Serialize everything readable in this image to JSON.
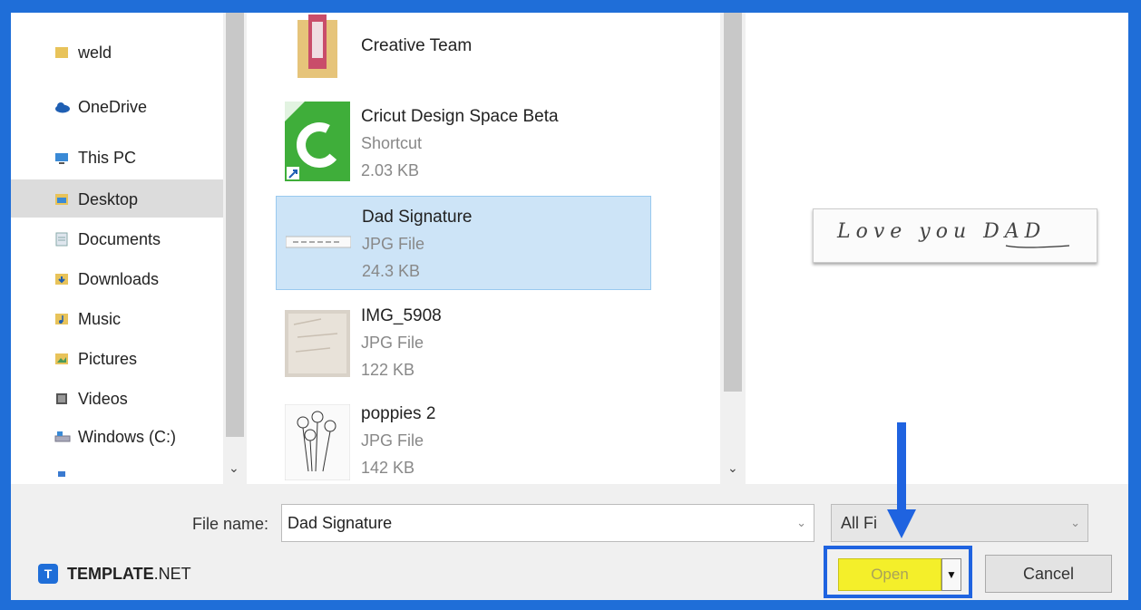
{
  "nav": {
    "items": [
      {
        "label": "weld",
        "icon": "folder-icon"
      },
      {
        "label": "OneDrive",
        "icon": "cloud-icon"
      },
      {
        "label": "This PC",
        "icon": "computer-icon"
      },
      {
        "label": "Desktop",
        "icon": "desktop-folder-icon"
      },
      {
        "label": "Documents",
        "icon": "documents-folder-icon"
      },
      {
        "label": "Downloads",
        "icon": "downloads-folder-icon"
      },
      {
        "label": "Music",
        "icon": "music-folder-icon"
      },
      {
        "label": "Pictures",
        "icon": "pictures-folder-icon"
      },
      {
        "label": "Videos",
        "icon": "videos-folder-icon"
      },
      {
        "label": "Windows (C:)",
        "icon": "drive-icon"
      }
    ],
    "selected": "Desktop"
  },
  "files": [
    {
      "name": "Creative Team",
      "type": "",
      "size": ""
    },
    {
      "name": "Cricut Design Space Beta",
      "type": "Shortcut",
      "size": "2.03 KB"
    },
    {
      "name": "Dad Signature",
      "type": "JPG File",
      "size": "24.3 KB"
    },
    {
      "name": "IMG_5908",
      "type": "JPG File",
      "size": "122 KB"
    },
    {
      "name": "poppies 2",
      "type": "JPG File",
      "size": "142 KB"
    }
  ],
  "preview": {
    "text": "Love you DAD"
  },
  "bottom": {
    "file_name_label": "File name:",
    "file_name_value": "Dad Signature",
    "filter_value": "All Fi",
    "open_label": "Open",
    "cancel_label": "Cancel"
  },
  "branding": {
    "logo_bold": "TEMPLATE",
    "logo_rest": ".NET"
  },
  "colors": {
    "frame": "#1f6ed8",
    "selection": "#cde4f7",
    "highlight": "#f4ef2a"
  }
}
